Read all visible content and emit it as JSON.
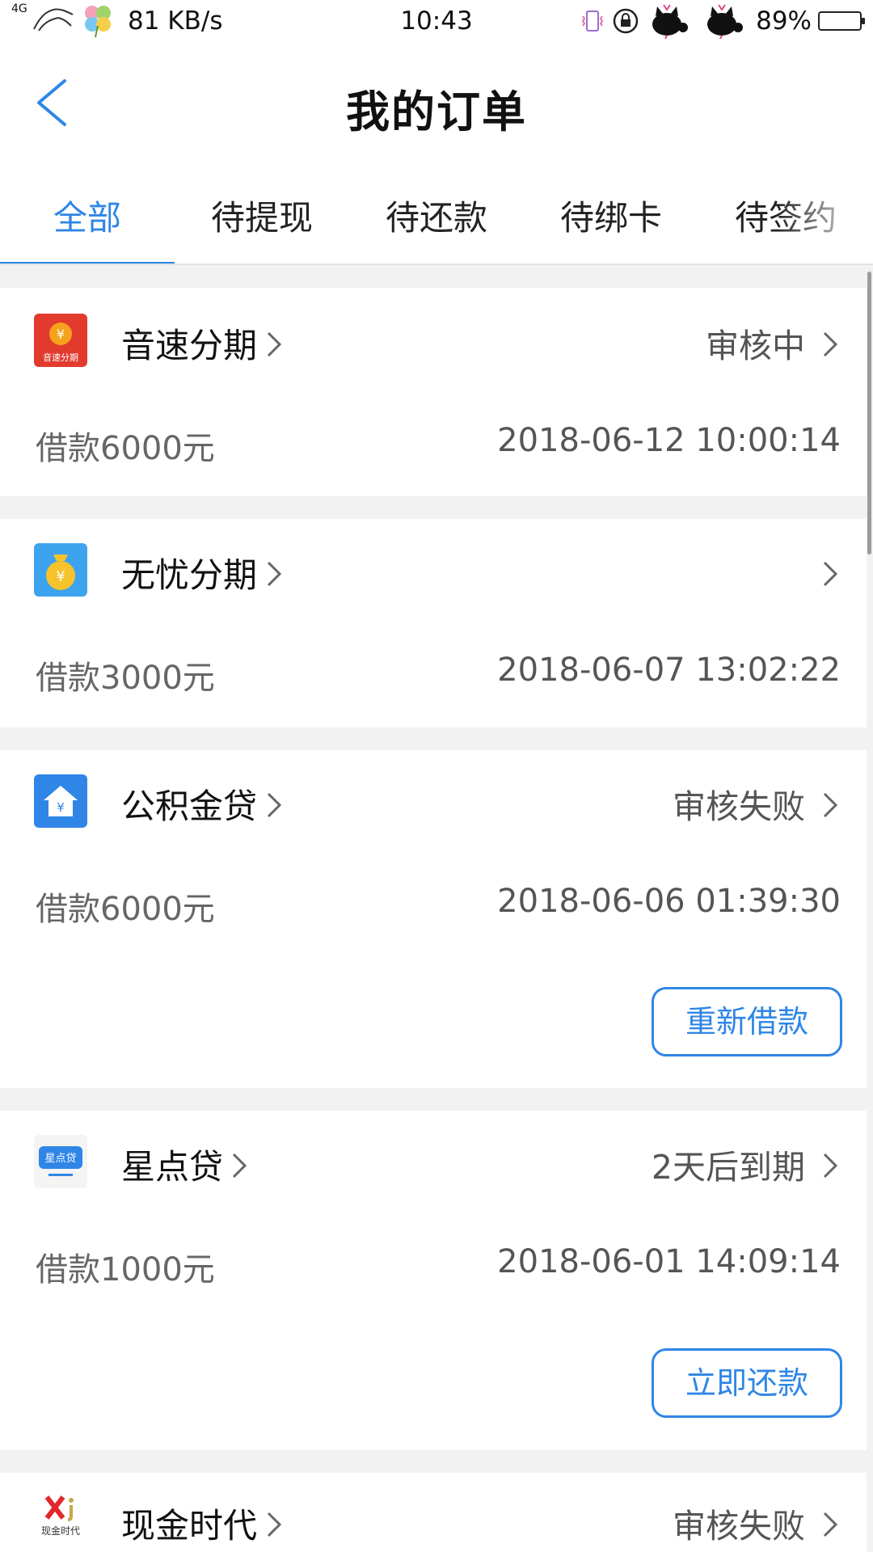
{
  "status_bar": {
    "network": "4G",
    "speed": "81 KB/s",
    "time": "10:43",
    "battery": "89%"
  },
  "header": {
    "title": "我的订单",
    "back_icon": "chevron-left-icon"
  },
  "tabs": [
    {
      "label": "全部",
      "active": true
    },
    {
      "label": "待提现",
      "active": false
    },
    {
      "label": "待还款",
      "active": false
    },
    {
      "label": "待绑卡",
      "active": false
    },
    {
      "label": "待签约",
      "active": false
    }
  ],
  "orders": [
    {
      "name": "音速分期",
      "icon": "yinsu-app-icon",
      "icon_text": "音速分期",
      "status": "审核中",
      "amount": "借款6000元",
      "date": "2018-06-12 10:00:14"
    },
    {
      "name": "无忧分期",
      "icon": "wuyou-app-icon",
      "status": "",
      "amount": "借款3000元",
      "date": "2018-06-07 13:02:22"
    },
    {
      "name": "公积金贷",
      "icon": "house-app-icon",
      "status": "审核失败",
      "amount": "借款6000元",
      "date": "2018-06-06 01:39:30",
      "action": "重新借款"
    },
    {
      "name": "星点贷",
      "icon": "xingdian-app-icon",
      "icon_text": "星点贷",
      "status": "2天后到期",
      "amount": "借款1000元",
      "date": "2018-06-01 14:09:14",
      "action": "立即还款"
    },
    {
      "name": "现金时代",
      "icon": "xianjin-app-icon",
      "icon_text": "现金时代",
      "status": "审核失败"
    }
  ],
  "colors": {
    "accent": "#2f86e6",
    "background": "#f2f2f2"
  }
}
